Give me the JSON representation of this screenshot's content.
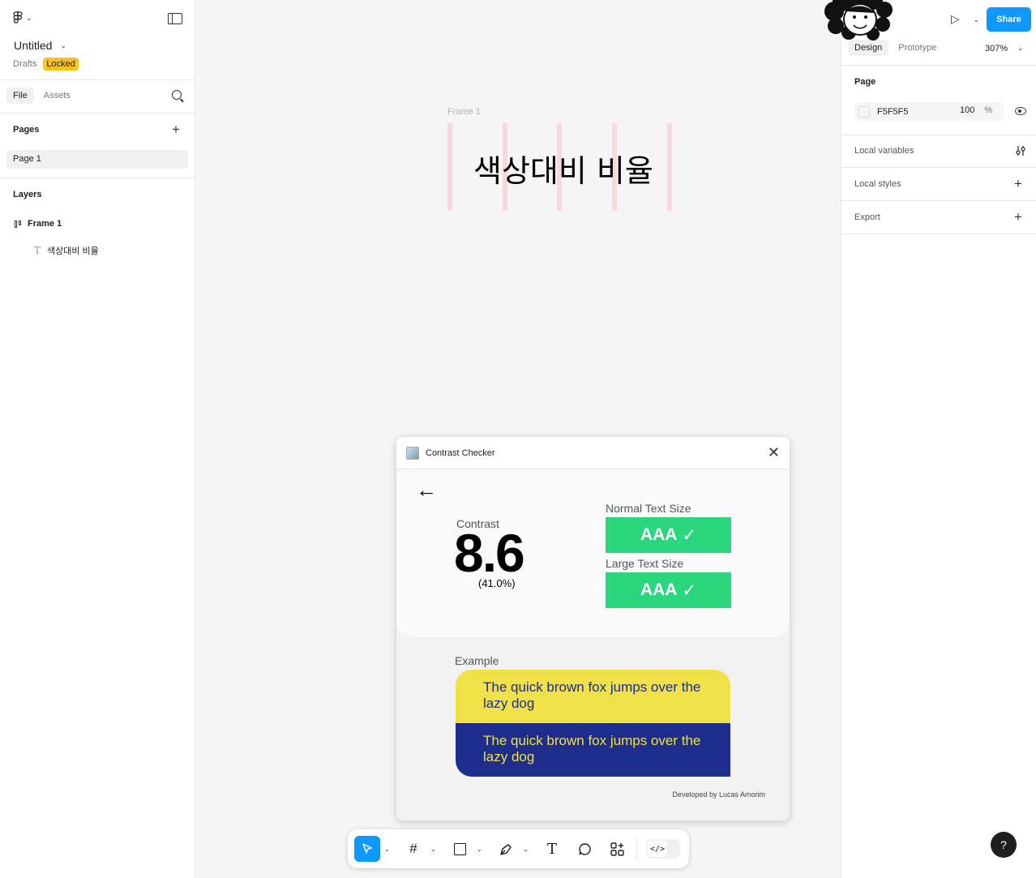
{
  "app": {
    "file_name": "Untitled",
    "location": "Drafts",
    "lock_badge": "Locked"
  },
  "left_panel": {
    "tabs": [
      {
        "label": "File",
        "active": true
      },
      {
        "label": "Assets",
        "active": false
      }
    ],
    "pages_title": "Pages",
    "pages": [
      {
        "label": "Page 1",
        "selected": true
      }
    ],
    "layers_title": "Layers",
    "layers": [
      {
        "label": "Frame 1",
        "type": "frame-icon"
      },
      {
        "label": "색상대비 비율",
        "type": "text-icon"
      }
    ]
  },
  "canvas": {
    "frame_label": "Frame 1",
    "text": "색상대비 비율"
  },
  "plugin": {
    "title": "Contrast Checker",
    "contrast_label": "Contrast",
    "contrast_value": "8.6",
    "contrast_percent": "(41.0%)",
    "normal_size_label": "Normal Text Size",
    "normal_result": "AAA",
    "large_size_label": "Large Text Size",
    "large_result": "AAA",
    "example_label": "Example",
    "example_text": "The quick brown fox jumps over the lazy dog",
    "example_colors": {
      "yellow": "#efe147",
      "navy": "#1e2d8b"
    },
    "pass_color": "#2bd67f",
    "credit": "Developed by Lucas Amorim"
  },
  "toolbar": {
    "tools": [
      "move-icon",
      "frame-icon",
      "rectangle-icon",
      "pen-icon",
      "text-icon",
      "comment-icon",
      "actions-icon",
      "dev-mode-icon"
    ],
    "text_tool_glyph": "T"
  },
  "right_panel": {
    "share_label": "Share",
    "tabs": [
      {
        "label": "Design",
        "active": true
      },
      {
        "label": "Prototype",
        "active": false
      }
    ],
    "zoom": "307%",
    "page_section": "Page",
    "page_color": "F5F5F5",
    "page_opacity": "100",
    "opacity_unit": "%",
    "local_variables": "Local variables",
    "local_styles": "Local styles",
    "export": "Export",
    "help": "?",
    "accent": "#0d99ff"
  }
}
